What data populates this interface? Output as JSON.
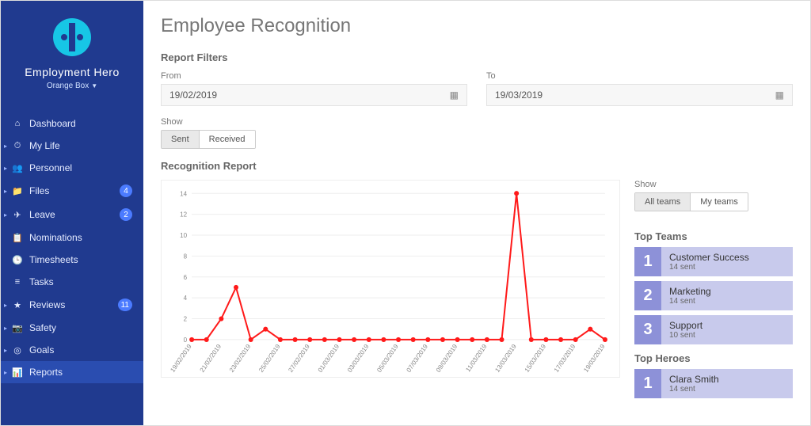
{
  "brand": {
    "name": "Employment Hero",
    "org": "Orange Box"
  },
  "nav": {
    "items": [
      {
        "label": "Dashboard",
        "icon": "⌂",
        "expandable": false
      },
      {
        "label": "My Life",
        "icon": "⏱",
        "expandable": true
      },
      {
        "label": "Personnel",
        "icon": "👥",
        "expandable": true
      },
      {
        "label": "Files",
        "icon": "📁",
        "expandable": true,
        "badge": "4"
      },
      {
        "label": "Leave",
        "icon": "✈",
        "expandable": true,
        "badge": "2"
      },
      {
        "label": "Nominations",
        "icon": "📋",
        "expandable": false
      },
      {
        "label": "Timesheets",
        "icon": "🕒",
        "expandable": false
      },
      {
        "label": "Tasks",
        "icon": "≡",
        "expandable": false
      },
      {
        "label": "Reviews",
        "icon": "★",
        "expandable": true,
        "badge": "11"
      },
      {
        "label": "Safety",
        "icon": "📷",
        "expandable": true
      },
      {
        "label": "Goals",
        "icon": "◎",
        "expandable": true
      },
      {
        "label": "Reports",
        "icon": "📊",
        "expandable": true,
        "active": true
      }
    ]
  },
  "page": {
    "title": "Employee Recognition"
  },
  "filters": {
    "heading": "Report Filters",
    "from_label": "From",
    "from_value": "19/02/2019",
    "to_label": "To",
    "to_value": "19/03/2019",
    "show_label": "Show",
    "show_options": {
      "sent": "Sent",
      "received": "Received",
      "active": "sent"
    }
  },
  "report": {
    "heading": "Recognition Report"
  },
  "chart_data": {
    "type": "line",
    "xlabel": "",
    "ylabel": "",
    "ylim": [
      0,
      14
    ],
    "yticks": [
      0,
      2,
      4,
      6,
      8,
      10,
      12,
      14
    ],
    "categories": [
      "19/02/2019",
      "21/02/2019",
      "23/02/2019",
      "25/02/2019",
      "27/02/2019",
      "01/03/2019",
      "03/03/2019",
      "05/03/2019",
      "07/03/2019",
      "09/03/2019",
      "11/03/2019",
      "13/03/2019",
      "15/03/2019",
      "17/03/2019",
      "19/03/2019"
    ],
    "x_all": [
      "19/02/2019",
      "20/02/2019",
      "21/02/2019",
      "22/02/2019",
      "23/02/2019",
      "24/02/2019",
      "25/02/2019",
      "26/02/2019",
      "27/02/2019",
      "28/02/2019",
      "01/03/2019",
      "02/03/2019",
      "03/03/2019",
      "04/03/2019",
      "05/03/2019",
      "06/03/2019",
      "07/03/2019",
      "08/03/2019",
      "09/03/2019",
      "10/03/2019",
      "11/03/2019",
      "12/03/2019",
      "13/03/2019",
      "14/03/2019",
      "15/03/2019",
      "16/03/2019",
      "17/03/2019",
      "18/03/2019",
      "19/03/2019"
    ],
    "values": [
      0,
      0,
      2,
      5,
      0,
      1,
      0,
      0,
      0,
      0,
      0,
      0,
      0,
      0,
      0,
      0,
      0,
      0,
      0,
      0,
      0,
      0,
      14,
      0,
      0,
      0,
      0,
      1,
      0
    ],
    "color": "#ff1a1a"
  },
  "side": {
    "show_label": "Show",
    "show_options": {
      "all": "All teams",
      "my": "My teams",
      "active": "all"
    },
    "top_teams_heading": "Top Teams",
    "top_teams": [
      {
        "rank": "1",
        "name": "Customer Success",
        "sub": "14 sent"
      },
      {
        "rank": "2",
        "name": "Marketing",
        "sub": "14 sent"
      },
      {
        "rank": "3",
        "name": "Support",
        "sub": "10 sent"
      }
    ],
    "top_heroes_heading": "Top Heroes",
    "top_heroes": [
      {
        "rank": "1",
        "name": "Clara Smith",
        "sub": "14 sent"
      }
    ]
  }
}
